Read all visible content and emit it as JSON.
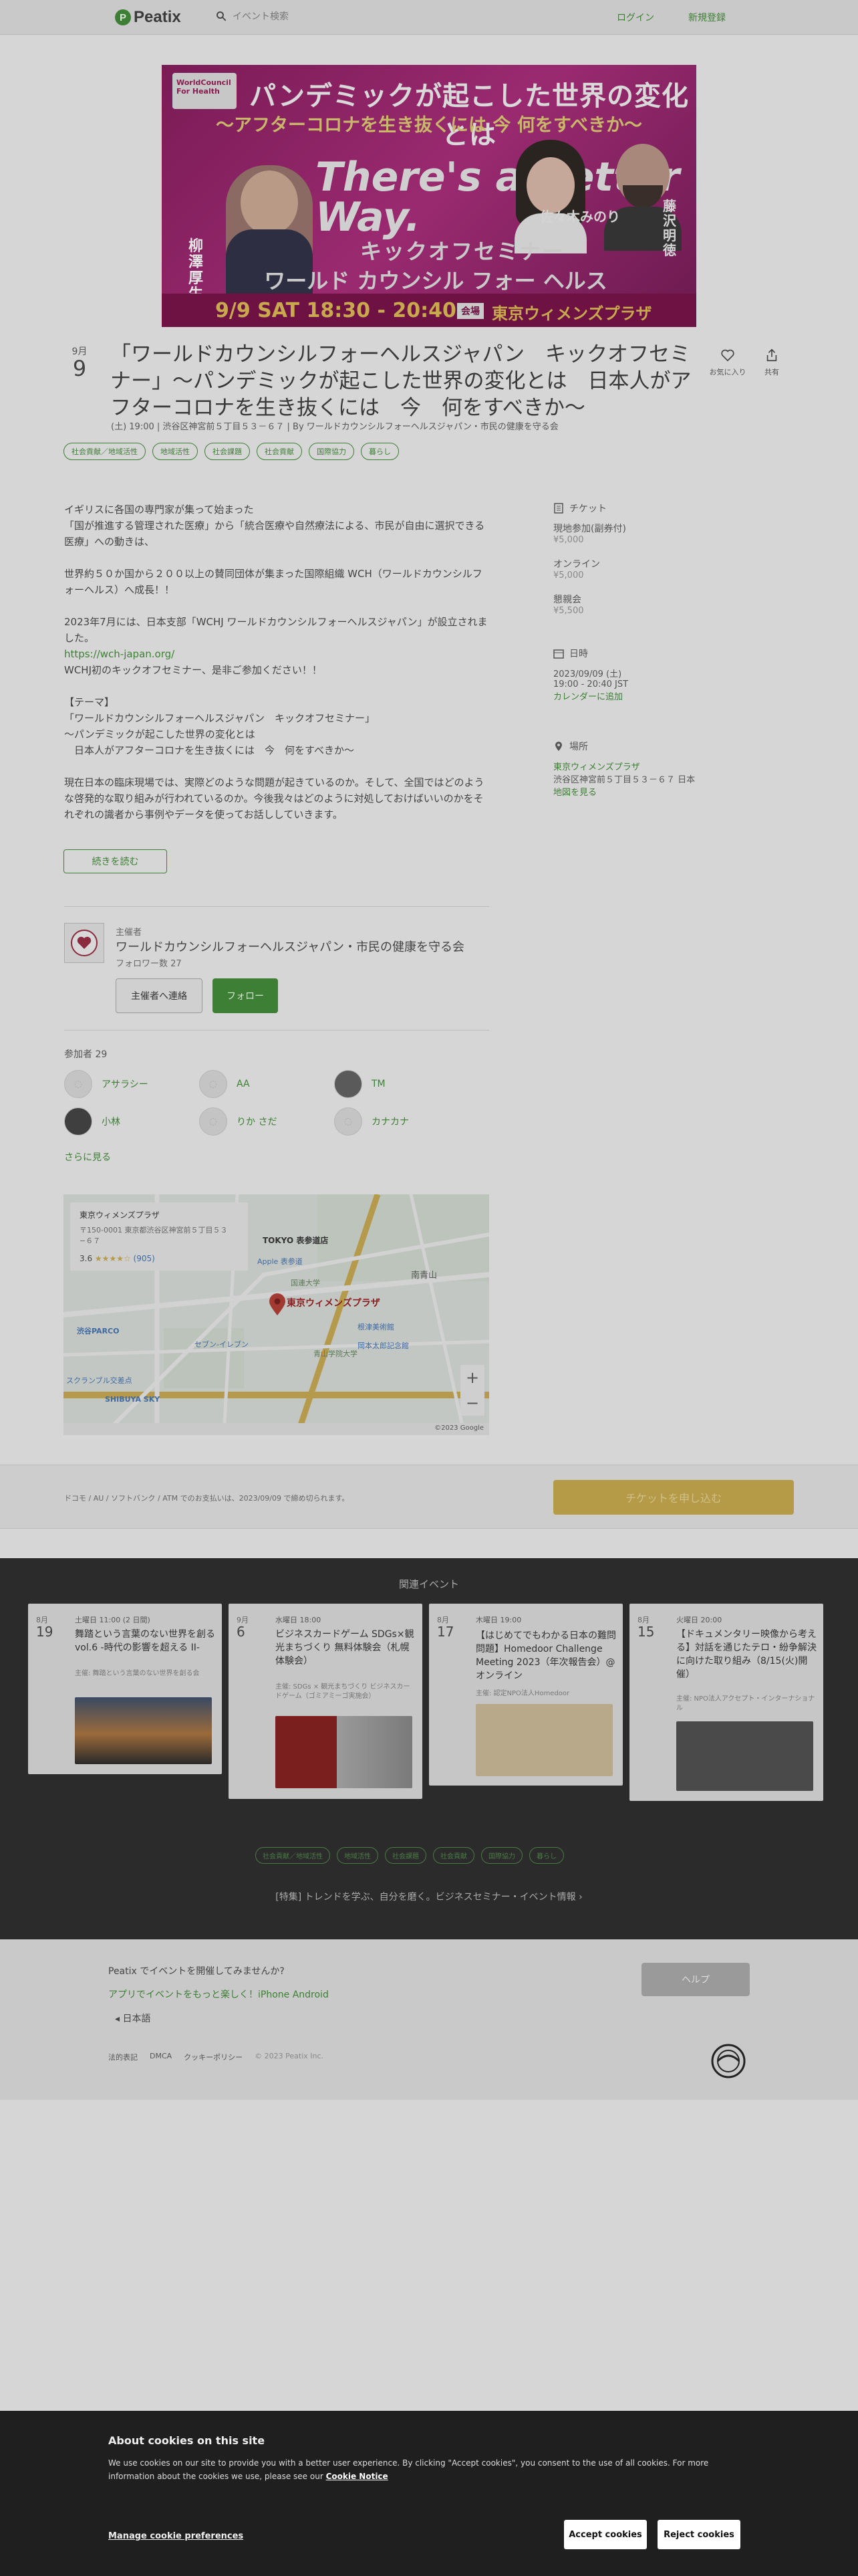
{
  "header": {
    "logo": "Peatix",
    "search_placeholder": "イベント検索",
    "login": "ログイン",
    "signup": "新規登録"
  },
  "banner": {
    "logo_text": "WorldCouncil For Health",
    "headline": "パンデミックが起こした世界の変化とは",
    "subheadline": "～アフターコロナを生き抜くには 今 何をすべきか～",
    "slogan": "There's a Better Way.",
    "seminar": "キックオフセミナー",
    "org": "ワールド カウンシル フォー ヘルスジャパン",
    "speaker1": "柳澤厚生",
    "speaker2": "佐々木みのり",
    "speaker3": "藤沢明徳",
    "datetime": "9/9 SAT 18:30 - 20:40",
    "venue_tag": "会場",
    "venue": "東京ウィメンズプラザ"
  },
  "event": {
    "month": "9月",
    "day": "9",
    "title": "「ワールドカウンシルフォーヘルスジャパン　キックオフセミナー」～パンデミックが起こした世界の変化とは　日本人がアフターコロナを生き抜くには　今　何をすべきか～",
    "meta": "(土) 19:00 | 渋谷区神宮前５丁目５３－６７ | By ワールドカウンシルフォーヘルスジャパン・市民の健康を守る会",
    "favorite_label": "お気に入り",
    "share_label": "共有",
    "tags": [
      "社会貢献／地域活性",
      "地域活性",
      "社会課題",
      "社会貢献",
      "国際協力",
      "暮らし"
    ]
  },
  "description": {
    "p1": "イギリスに各国の専門家が集って始まった\n「国が推進する管理された医療」から「統合医療や自然療法による、市民が自由に選択できる医療」への動きは、",
    "p2": "世界約５０か国から２００以上の賛同団体が集まった国際組織 WCH（ワールドカウンシルフォーヘルス）へ成長！！",
    "p3": "2023年7月には、日本支部「WCHJ ワールドカウンシルフォーヘルスジャパン」が設立されました。",
    "link": "https://wch-japan.org/",
    "p4": "WCHJ初のキックオフセミナー、是非ご参加ください！！",
    "theme": "【テーマ】\n「ワールドカウンシルフォーヘルスジャパン　キックオフセミナー」\n～パンデミックが起こした世界の変化とは\n　日本人がアフターコロナを生き抜くには　今　何をすべきか～",
    "p5": "現在日本の臨床現場では、実際どのような問題が起きているのか。そして、全国ではどのような啓発的な取り組みが行われているのか。今後我々はどのように対処しておけばいいのかをそれぞれの識者から事例やデータを使ってお話ししていきます。",
    "read_more": "続きを読む"
  },
  "sidebar": {
    "ticket_heading": "チケット",
    "tickets": [
      {
        "name": "現地参加(副券付)",
        "price": "¥5,000"
      },
      {
        "name": "オンライン",
        "price": "¥5,000"
      },
      {
        "name": "懇親会",
        "price": "¥5,500"
      }
    ],
    "date_heading": "日時",
    "date": "2023/09/09 (土)",
    "time": "19:00 - 20:40 JST",
    "calendar": "カレンダーに追加",
    "place_heading": "場所",
    "venue": "東京ウィメンズプラザ",
    "address": "渋谷区神宮前５丁目５３－６７ 日本",
    "map_link": "地図を見る"
  },
  "organizer": {
    "label": "主催者",
    "name": "ワールドカウンシルフォーヘルスジャパン・市民の健康を守る会",
    "followers": "フォロワー数 27",
    "contact": "主催者へ連絡",
    "follow": "フォロー"
  },
  "participants": {
    "heading": "参加者 29",
    "people": [
      "アサラシー",
      "AA",
      "TM",
      "小林",
      "りか さだ",
      "カナカナ"
    ],
    "see_more": "さらに見る"
  },
  "map": {
    "card_title": "東京ウィメンズプラザ",
    "card_addr": "〒150-0001 東京都渋谷区神宮前５丁目５３−６７",
    "rating": "3.6",
    "reviews": "(905)",
    "pin_label": "東京ウィメンズプラザ",
    "places": [
      "TOKYO 表参道店",
      "Apple 表参道",
      "青山学院大学",
      "国連大学",
      "渋谷PARCO",
      "SHIBUYA SKY",
      "セブン-イレブン",
      "スクランブル交差点",
      "南青山",
      "根津美術館",
      "岡本太郎記念館"
    ],
    "footer": "©2023 Google"
  },
  "purchase": {
    "note": "ドコモ / AU / ソフトバンク / ATM でのお支払いは、2023/09/09 で締め切られます。",
    "button": "チケットを申し込む"
  },
  "related": {
    "heading": "関連イベント",
    "events": [
      {
        "month": "8月",
        "day": "19",
        "date": "土曜日 11:00 (2 日間)",
        "title": "舞踏という言葉のない世界を創るvol.6 -時代の影響を超える II-",
        "sub": "主催: 舞踏という言葉のない世界を創る会"
      },
      {
        "month": "9月",
        "day": "6",
        "date": "水曜日 18:00",
        "title": "ビジネスカードゲーム SDGs×観光まちづくり 無料体験会（札幌体験会）",
        "sub": "主催: SDGs × 観光まちづくり ビジネスカードゲーム（ゴミアミーゴ実施会）"
      },
      {
        "month": "8月",
        "day": "17",
        "date": "木曜日 19:00",
        "title": "【はじめてでもわかる日本の難問問題】Homedoor Challenge Meeting 2023（年次報告会）@オンライン",
        "sub": "主催: 認定NPO法人Homedoor"
      },
      {
        "month": "8月",
        "day": "15",
        "date": "火曜日 20:00",
        "title": "【ドキュメンタリー映像から考える】対話を通じたテロ・紛争解決に向けた取り組み（8/15(火)開催）",
        "sub": "主催: NPO法人アクセプト・インターナショナル"
      }
    ],
    "tags": [
      "社会貢献／地域活性",
      "地域活性",
      "社会課題",
      "社会貢献",
      "国際協力",
      "暮らし"
    ],
    "special": "[特集] トレンドを学ぶ、自分を磨く。ビジネスセミナー・イベント情報"
  },
  "footer": {
    "host": "Peatix でイベントを開催してみませんか?",
    "app": "アプリでイベントをもっと楽しく！iPhone Android",
    "lang": "日本語",
    "links": [
      "法的表記",
      "DMCA",
      "クッキーポリシー"
    ],
    "copyright": "© 2023 Peatix Inc.",
    "help": "ヘルプ"
  },
  "cookie": {
    "title": "About cookies on this site",
    "text": "We use cookies on our site to provide you with a better user experience. By clicking \"Accept cookies\", you consent to the use of all cookies. For more information about the cookies we use, please see our",
    "notice": "Cookie Notice",
    "manage": "Manage cookie preferences",
    "accept": "Accept cookies",
    "reject": "Reject cookies"
  }
}
